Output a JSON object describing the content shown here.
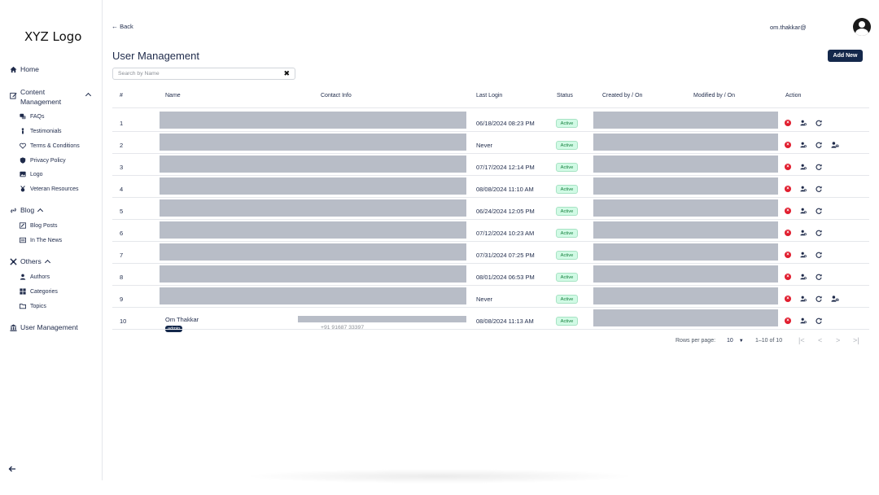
{
  "sidebar": {
    "logo": "XYZ Logo",
    "home": "Home",
    "content_management": "Content Management",
    "content_items": [
      "FAQs",
      "Testimonials",
      "Terms & Conditions",
      "Privacy Policy",
      "Logo",
      "Veteran Resources"
    ],
    "blog": "Blog",
    "blog_items": [
      "Blog Posts",
      "In The News"
    ],
    "others": "Others",
    "others_items": [
      "Authors",
      "Categories",
      "Topics"
    ],
    "user_management": "User Management",
    "collapse_icon": "arrow-left-icon"
  },
  "header": {
    "back": "Back",
    "username": "om.thakkar@",
    "page_title": "User Management",
    "add_new": "Add New"
  },
  "search": {
    "placeholder": "Search by Name"
  },
  "table": {
    "columns": [
      "#",
      "Name",
      "Contact Info",
      "Last Login",
      "Status",
      "Created by / On",
      "Modified by / On",
      "Action"
    ],
    "rows": [
      {
        "num": "1",
        "last_login": "06/18/2024 08:23 PM",
        "status": "Active",
        "extra_action": false
      },
      {
        "num": "2",
        "last_login": "Never",
        "status": "Active",
        "extra_action": true
      },
      {
        "num": "3",
        "last_login": "07/17/2024 12:14 PM",
        "status": "Active",
        "extra_action": false
      },
      {
        "num": "4",
        "last_login": "08/08/2024 11:10 AM",
        "status": "Active",
        "extra_action": false
      },
      {
        "num": "5",
        "last_login": "06/24/2024 12:05 PM",
        "status": "Active",
        "extra_action": false
      },
      {
        "num": "6",
        "last_login": "07/12/2024 10:23 AM",
        "status": "Active",
        "extra_action": false
      },
      {
        "num": "7",
        "last_login": "07/31/2024 07:25 PM",
        "status": "Active",
        "extra_action": false
      },
      {
        "num": "8",
        "last_login": "08/01/2024 06:53 PM",
        "status": "Active",
        "extra_action": false
      },
      {
        "num": "9",
        "last_login": "Never",
        "status": "Active",
        "extra_action": true
      },
      {
        "num": "10",
        "name": "Om Thakkar",
        "role": "admin",
        "phone": "+91 91687 33397",
        "last_login": "08/08/2024 11:13 AM",
        "status": "Active",
        "extra_action": false
      }
    ]
  },
  "pagination": {
    "rows_per_page_label": "Rows per page:",
    "rows_per_page": "10",
    "range": "1–10 of 10"
  },
  "colors": {
    "primary": "#14284b",
    "active_bg": "#d1fae5",
    "active_text": "#15803d",
    "deactivate": "#e11d2e",
    "redaction": "#b8bdc7"
  }
}
